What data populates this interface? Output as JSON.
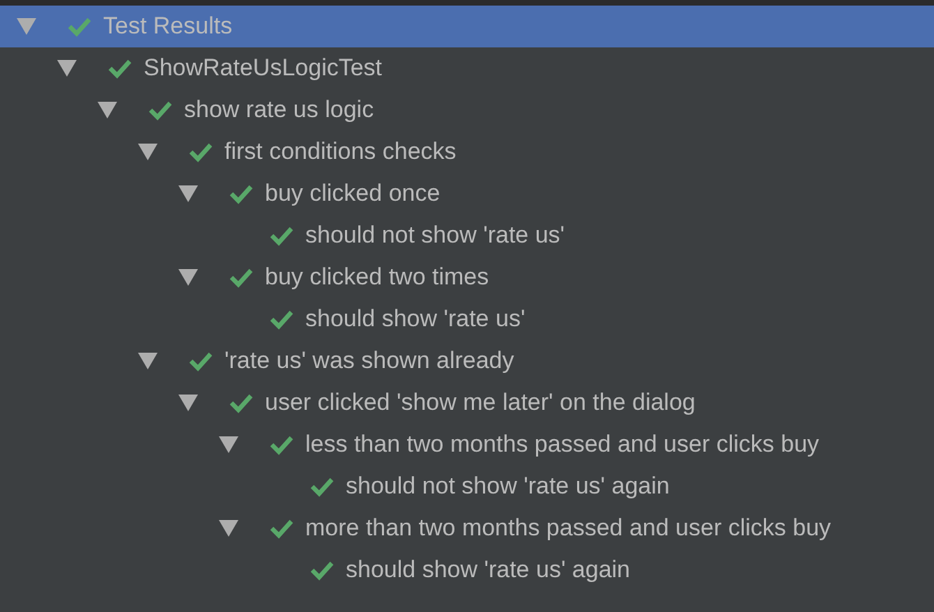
{
  "tree": [
    {
      "label": "Test Results",
      "passed": true,
      "selected": true,
      "expanded": true,
      "children": [
        {
          "label": "ShowRateUsLogicTest",
          "passed": true,
          "selected": false,
          "expanded": true,
          "children": [
            {
              "label": "show rate us logic",
              "passed": true,
              "selected": false,
              "expanded": true,
              "children": [
                {
                  "label": "first conditions checks",
                  "passed": true,
                  "selected": false,
                  "expanded": true,
                  "children": [
                    {
                      "label": "buy clicked once",
                      "passed": true,
                      "selected": false,
                      "expanded": true,
                      "children": [
                        {
                          "label": "should not show 'rate us'",
                          "passed": true,
                          "selected": false
                        }
                      ]
                    },
                    {
                      "label": "buy clicked two times",
                      "passed": true,
                      "selected": false,
                      "expanded": true,
                      "children": [
                        {
                          "label": "should show 'rate us'",
                          "passed": true,
                          "selected": false
                        }
                      ]
                    }
                  ]
                },
                {
                  "label": "'rate us' was shown already",
                  "passed": true,
                  "selected": false,
                  "expanded": true,
                  "children": [
                    {
                      "label": "user clicked 'show me later' on the dialog",
                      "passed": true,
                      "selected": false,
                      "expanded": true,
                      "children": [
                        {
                          "label": "less than two months passed and user clicks buy",
                          "passed": true,
                          "selected": false,
                          "expanded": true,
                          "children": [
                            {
                              "label": "should not show 'rate us' again",
                              "passed": true,
                              "selected": false
                            }
                          ]
                        },
                        {
                          "label": "more than two months passed and user clicks buy",
                          "passed": true,
                          "selected": false,
                          "expanded": true,
                          "children": [
                            {
                              "label": "should show 'rate us' again",
                              "passed": true,
                              "selected": false
                            }
                          ]
                        }
                      ]
                    }
                  ]
                }
              ]
            }
          ]
        }
      ]
    }
  ]
}
